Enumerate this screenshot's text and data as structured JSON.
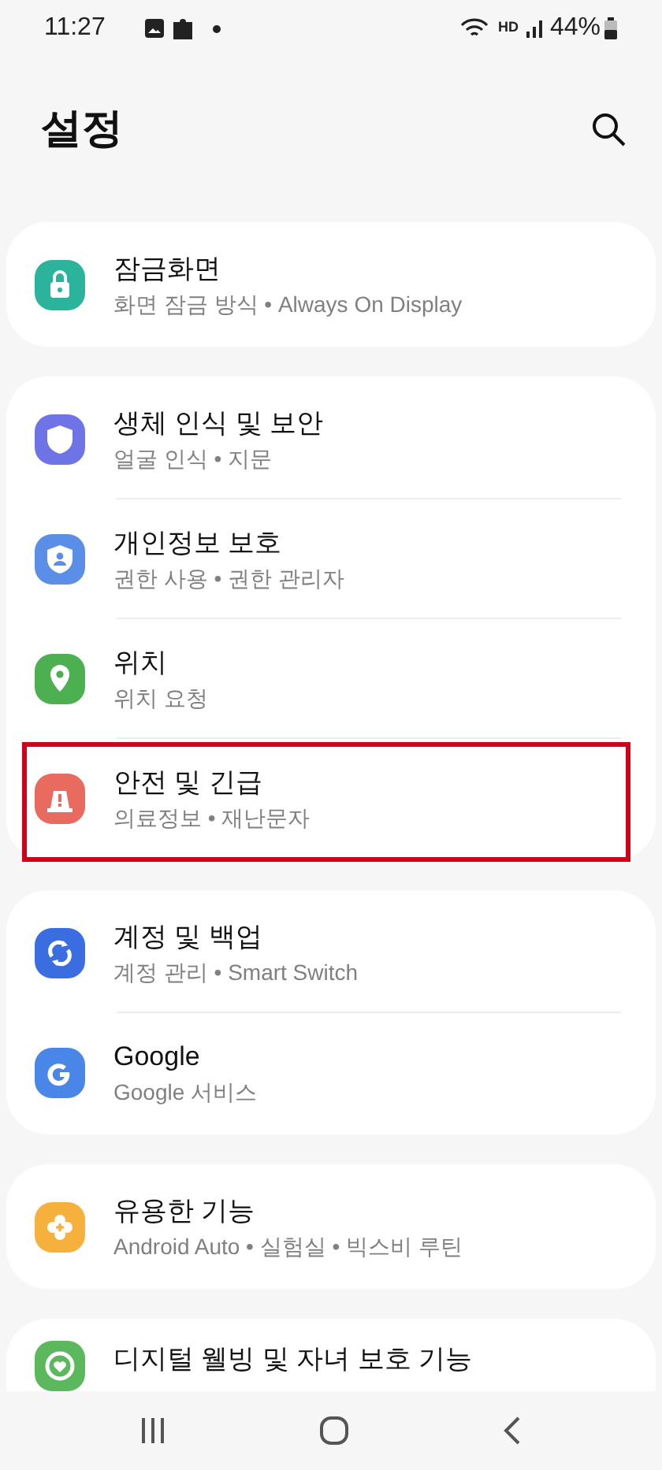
{
  "status_bar": {
    "time": "11:27",
    "hd_label": "HD",
    "battery": "44%"
  },
  "header": {
    "title": "설정"
  },
  "groups": [
    {
      "items": [
        {
          "title": "잠금화면",
          "subtitle": "화면 잠금 방식 • Always On Display",
          "kind": "lock",
          "color": "#2bb39b",
          "highlighted": false
        }
      ]
    },
    {
      "items": [
        {
          "title": "생체 인식 및 보안",
          "subtitle": "얼굴 인식 • 지문",
          "kind": "shield",
          "color": "#6e73e6",
          "highlighted": false
        },
        {
          "title": "개인정보 보호",
          "subtitle": "권한 사용 • 권한 관리자",
          "kind": "privacy",
          "color": "#5b8ee6",
          "highlighted": false
        },
        {
          "title": "위치",
          "subtitle": "위치 요청",
          "kind": "location",
          "color": "#4caf50",
          "highlighted": false
        },
        {
          "title": "안전 및 긴급",
          "subtitle": "의료정보 • 재난문자",
          "kind": "alert",
          "color": "#e96a5e",
          "highlighted": true
        }
      ]
    },
    {
      "items": [
        {
          "title": "계정 및 백업",
          "subtitle": "계정 관리 • Smart Switch",
          "kind": "sync",
          "color": "#3a6ee0",
          "highlighted": false
        },
        {
          "title": "Google",
          "subtitle": "Google 서비스",
          "kind": "google",
          "color": "#4a86e8",
          "highlighted": false
        }
      ]
    },
    {
      "items": [
        {
          "title": "유용한 기능",
          "subtitle": "Android Auto • 실험실 • 빅스비 루틴",
          "kind": "flower",
          "color": "#f6b13d",
          "highlighted": false
        }
      ]
    },
    {
      "items": [
        {
          "title": "디지털 웰빙 및 자녀 보호 기능",
          "kind": "wellbeing",
          "color": "#5cb85c",
          "highlighted": false
        }
      ]
    }
  ]
}
